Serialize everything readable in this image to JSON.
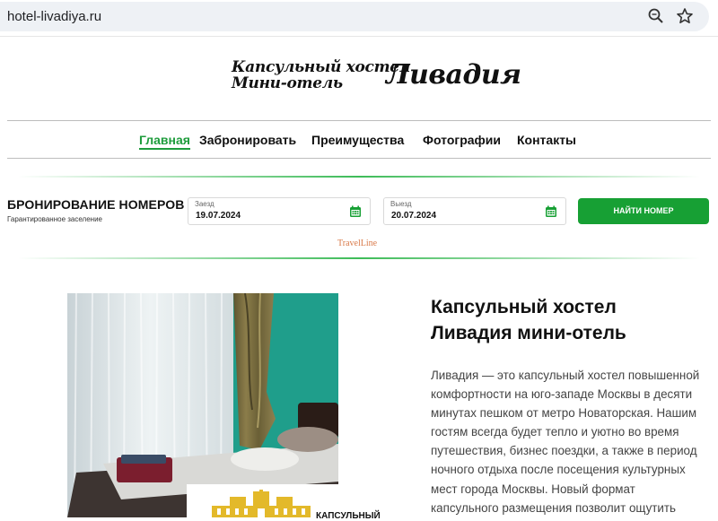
{
  "browser": {
    "url": "hotel-livadiya.ru",
    "icons": [
      "zoom-icon",
      "star-icon"
    ]
  },
  "header": {
    "logo_line1": "Капсульный хостел",
    "logo_line2": "Мини-отель",
    "logo_name": "Ливадия"
  },
  "nav": {
    "items": [
      {
        "label": "Главная",
        "active": true
      },
      {
        "label": "Забронировать",
        "active": false
      },
      {
        "label": "Преимущества",
        "active": false
      },
      {
        "label": "Фотографии",
        "active": false
      },
      {
        "label": "Контакты",
        "active": false
      }
    ]
  },
  "booking": {
    "title": "БРОНИРОВАНИЕ НОМЕРОВ",
    "subtitle": "Гарантированное заселение",
    "checkin_label": "Заезд",
    "checkin_value": "19.07.2024",
    "checkout_label": "Выезд",
    "checkout_value": "20.07.2024",
    "button_label": "НАЙТИ НОМЕР",
    "provider": "TravelLine"
  },
  "main": {
    "title": "Капсульный хостел Ливадия мини-отель",
    "body": "Ливадия — это капсульный хостел повышенной комфортности на юго-западе Москвы в десяти минутах пешком от метро Новаторская. Нашим гостям всегда будет тепло и уютно во время путешествия, бизнес поездки, а также в период ночного отдыха после посещения культурных мест города Москвы. Новый формат капсульного размещения позволит ощутить",
    "badge_text": "КАПСУЛЬНЫЙ"
  },
  "colors": {
    "accent": "#1e9c3c",
    "button": "#17a034",
    "wall": "#1f9e8b"
  }
}
